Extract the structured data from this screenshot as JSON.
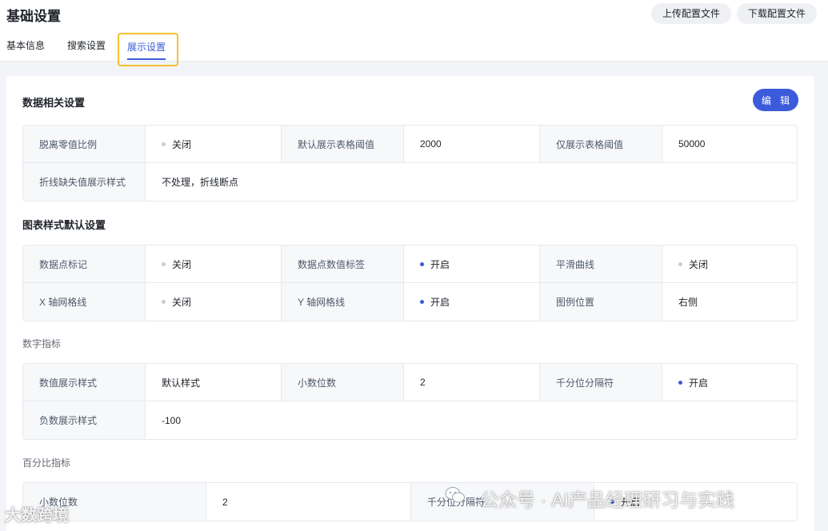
{
  "header": {
    "title": "基础设置",
    "upload_label": "上传配置文件",
    "download_label": "下载配置文件"
  },
  "tabs": [
    {
      "label": "基本信息",
      "active": false
    },
    {
      "label": "搜索设置",
      "active": false
    },
    {
      "label": "展示设置",
      "active": true
    }
  ],
  "sections": {
    "data": {
      "title": "数据相关设置",
      "edit_label": "编 辑",
      "rows": [
        [
          {
            "label": "脱离零值比例",
            "value": "关闭",
            "dot": "off"
          },
          {
            "label": "默认展示表格阈值",
            "value": "2000"
          },
          {
            "label": "仅展示表格阈值",
            "value": "50000"
          }
        ],
        [
          {
            "label": "折线缺失值展示样式",
            "value": "不处理，折线断点"
          }
        ]
      ]
    },
    "chart_style": {
      "title": "图表样式默认设置",
      "rows": [
        [
          {
            "label": "数据点标记",
            "value": "关闭",
            "dot": "off"
          },
          {
            "label": "数据点数值标签",
            "value": "开启",
            "dot": "on"
          },
          {
            "label": "平滑曲线",
            "value": "关闭",
            "dot": "off"
          }
        ],
        [
          {
            "label": "X 轴网格线",
            "value": "关闭",
            "dot": "off"
          },
          {
            "label": "Y 轴网格线",
            "value": "开启",
            "dot": "on"
          },
          {
            "label": "图例位置",
            "value": "右侧"
          }
        ]
      ]
    },
    "number": {
      "title": "数字指标",
      "rows": [
        [
          {
            "label": "数值展示样式",
            "value": "默认样式"
          },
          {
            "label": "小数位数",
            "value": "2"
          },
          {
            "label": "千分位分隔符",
            "value": "开启",
            "dot": "on"
          }
        ],
        [
          {
            "label": "负数展示样式",
            "value": "-100"
          }
        ]
      ]
    },
    "percent": {
      "title": "百分比指标",
      "rows": [
        [
          {
            "label": "小数位数",
            "value": "2"
          },
          {
            "label": "千分位分隔符",
            "value": "开启",
            "dot": "on"
          }
        ]
      ]
    }
  },
  "watermark": {
    "wechat": "公众号 · AI产品经理研习与实践",
    "brand": "大数跨境"
  },
  "colors": {
    "accent": "#3b5bdb",
    "highlight": "#f2c12e",
    "dot_off": "#c9cdd4"
  }
}
